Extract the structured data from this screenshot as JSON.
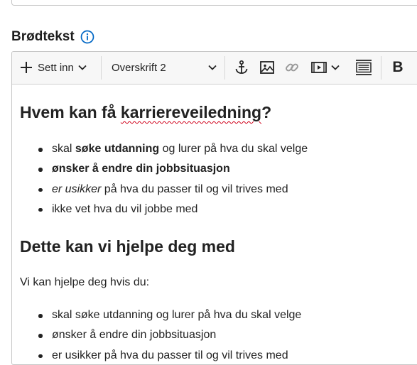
{
  "field": {
    "label": "Brødtekst",
    "info_icon": "info-circle-icon",
    "accent_color": "#0067c5"
  },
  "toolbar": {
    "insert_label": "Sett inn",
    "paragraph_style": "Overskrift 2",
    "bold_label": "B",
    "icons": [
      "plus-icon",
      "chevron-down-icon",
      "anchor-icon",
      "image-icon",
      "link-icon",
      "media-icon",
      "blockquote-icon",
      "bold-icon"
    ]
  },
  "content": {
    "heading1": {
      "prefix": "Hvem kan få ",
      "misspelled": "karriereveiledning",
      "suffix": "?"
    },
    "list1": [
      {
        "segments": [
          {
            "text": "skal ",
            "style": "normal"
          },
          {
            "text": "søke utdanning",
            "style": "bold"
          },
          {
            "text": " og lurer på hva du skal velge",
            "style": "normal"
          }
        ]
      },
      {
        "segments": [
          {
            "text": "ønsker å endre din jobbsituasjon",
            "style": "bold"
          }
        ]
      },
      {
        "segments": [
          {
            "text": "er usikker",
            "style": "italic"
          },
          {
            "text": " på hva du passer til og vil trives med",
            "style": "normal"
          }
        ]
      },
      {
        "segments": [
          {
            "text": "ikke vet hva du vil jobbe med",
            "style": "normal"
          }
        ]
      }
    ],
    "heading2": "Dette kan vi hjelpe deg med",
    "paragraph": "Vi kan hjelpe deg hvis du:",
    "list2": [
      "skal søke utdanning og lurer på hva du skal velge",
      "ønsker å endre din jobbsituasjon",
      "er usikker på hva du passer til og vil trives med"
    ],
    "spellcheck_color": "#d0021b"
  }
}
